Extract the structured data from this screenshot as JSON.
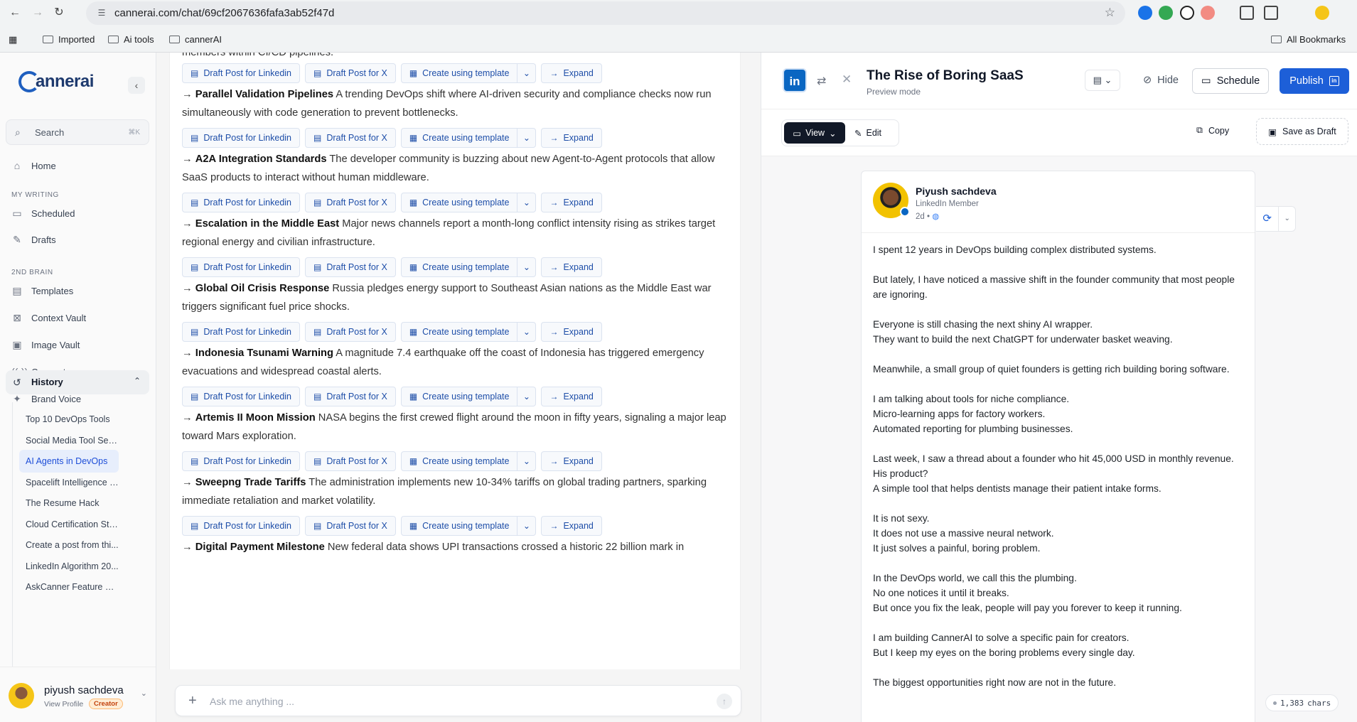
{
  "browser": {
    "url": "cannerai.com/chat/69cf2067636fafa3ab52f47d",
    "bookmarks": [
      "Imported",
      "Ai tools",
      "cannerAI"
    ],
    "all_bookmarks": "All Bookmarks"
  },
  "sidebar": {
    "logo": "annerai",
    "search_label": "Search",
    "search_shortcut": "⌘K",
    "home": "Home",
    "section_writing": "MY WRITING",
    "scheduled": "Scheduled",
    "drafts": "Drafts",
    "section_brain": "2ND BRAIN",
    "templates": "Templates",
    "context_vault": "Context Vault",
    "image_vault": "Image Vault",
    "connectors": "Connectors",
    "brand_voice": "Brand Voice",
    "history_label": "History",
    "history": [
      "Top 10 DevOps Tools",
      "Social Media Tool Sele...",
      "AI Agents in DevOps",
      "Spacelift Intelligence I...",
      "The Resume Hack",
      "Cloud Certification Str...",
      "Create a post from thi...",
      "LinkedIn Algorithm 20...",
      "AskCanner Feature Sh..."
    ],
    "active_history_index": 2,
    "profile": {
      "name": "piyush sachdeva",
      "view_profile": "View Profile",
      "badge": "Creator"
    }
  },
  "chat": {
    "partial_top": "members within CI/CD pipelines.",
    "topics": [
      {
        "title": "Parallel Validation Pipelines",
        "desc": "A trending DevOps shift where AI-driven security and compliance checks now run simultaneously with code generation to prevent bottlenecks."
      },
      {
        "title": "A2A Integration Standards",
        "desc": "The developer community is buzzing about new Agent-to-Agent protocols that allow SaaS products to interact without human middleware."
      },
      {
        "title": "Escalation in the Middle East",
        "desc": "Major news channels report a month-long conflict intensity rising as strikes target regional energy and civilian infrastructure."
      },
      {
        "title": "Global Oil Crisis Response",
        "desc": "Russia pledges energy support to Southeast Asian nations as the Middle East war triggers significant fuel price shocks."
      },
      {
        "title": "Indonesia Tsunami Warning",
        "desc": "A magnitude 7.4 earthquake off the coast of Indonesia has triggered emergency evacuations and widespread coastal alerts."
      },
      {
        "title": "Artemis II Moon Mission",
        "desc": "NASA begins the first crewed flight around the moon in fifty years, signaling a major leap toward Mars exploration."
      },
      {
        "title": "Sweepng Trade Tariffs",
        "desc": "The administration implements new 10-34% tariffs on global trading partners, sparking immediate retaliation and market volatility."
      },
      {
        "title": "Digital Payment Milestone",
        "desc": "New federal data shows UPI transactions crossed a historic 22 billion mark in"
      }
    ],
    "actions": {
      "linkedin": "Draft Post for Linkedin",
      "x": "Draft Post for X",
      "template": "Create using template",
      "expand": "Expand"
    },
    "input_placeholder": "Ask me anything ..."
  },
  "preview": {
    "title": "The Rise of Boring SaaS",
    "subtitle": "Preview mode",
    "hide": "Hide",
    "schedule": "Schedule",
    "publish": "Publish",
    "view": "View",
    "edit": "Edit",
    "copy": "Copy",
    "save_draft": "Save as Draft",
    "author": "Piyush sachdeva",
    "role": "LinkedIn Member",
    "time": "2d •",
    "post": [
      [
        "I spent 12 years in DevOps building complex distributed systems."
      ],
      [
        "But lately, I have noticed a massive shift in the founder community that most people are ignoring."
      ],
      [
        "Everyone is still chasing the next shiny AI wrapper.",
        "They want to build the next ChatGPT for underwater basket weaving."
      ],
      [
        "Meanwhile, a small group of quiet founders is getting rich building boring software."
      ],
      [
        "I am talking about tools for niche compliance.",
        "Micro-learning apps for factory workers.",
        "Automated reporting for plumbing businesses."
      ],
      [
        "Last week, I saw a thread about a founder who hit 45,000 USD in monthly revenue.",
        "His product?",
        "A simple tool that helps dentists manage their patient intake forms."
      ],
      [
        "It is not sexy.",
        "It does not use a massive neural network.",
        "It just solves a painful, boring problem."
      ],
      [
        "In the DevOps world, we call this the plumbing.",
        "No one notices it until it breaks.",
        "But once you fix the leak, people will pay you forever to keep it running."
      ],
      [
        "I am building CannerAI to solve a specific pain for creators.",
        "But I keep my eyes on the boring problems every single day."
      ],
      [
        "The biggest opportunities right now are not in the future."
      ]
    ],
    "char_count": "1,383",
    "char_unit": "chars"
  }
}
